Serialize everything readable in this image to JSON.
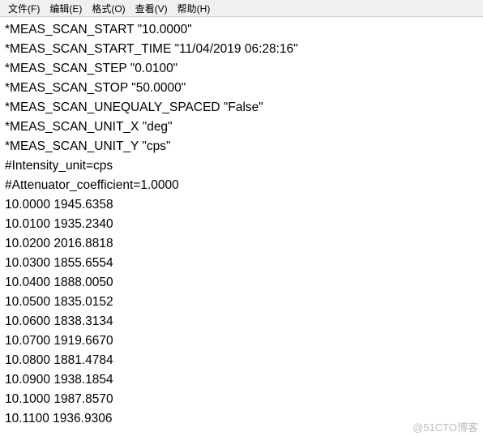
{
  "menubar": {
    "items": [
      {
        "label": "文件(F)"
      },
      {
        "label": "编辑(E)"
      },
      {
        "label": "格式(O)"
      },
      {
        "label": "查看(V)"
      },
      {
        "label": "帮助(H)"
      }
    ]
  },
  "document": {
    "header_lines": [
      "*MEAS_SCAN_START \"10.0000\"",
      "*MEAS_SCAN_START_TIME \"11/04/2019 06:28:16\"",
      "*MEAS_SCAN_STEP \"0.0100\"",
      "*MEAS_SCAN_STOP \"50.0000\"",
      "*MEAS_SCAN_UNEQUALY_SPACED \"False\"",
      "*MEAS_SCAN_UNIT_X \"deg\"",
      "*MEAS_SCAN_UNIT_Y \"cps\"",
      "#Intensity_unit=cps",
      "#Attenuator_coefficient=1.0000"
    ],
    "data_rows": [
      {
        "x": "10.0000",
        "y": "1945.6358"
      },
      {
        "x": "10.0100",
        "y": "1935.2340"
      },
      {
        "x": "10.0200",
        "y": "2016.8818"
      },
      {
        "x": "10.0300",
        "y": "1855.6554"
      },
      {
        "x": "10.0400",
        "y": "1888.0050"
      },
      {
        "x": "10.0500",
        "y": "1835.0152"
      },
      {
        "x": "10.0600",
        "y": "1838.3134"
      },
      {
        "x": "10.0700",
        "y": "1919.6670"
      },
      {
        "x": "10.0800",
        "y": "1881.4784"
      },
      {
        "x": "10.0900",
        "y": "1938.1854"
      },
      {
        "x": "10.1000",
        "y": "1987.8570"
      },
      {
        "x": "10.1100",
        "y": "1936.9306"
      }
    ]
  },
  "watermark": "@51CTO博客"
}
